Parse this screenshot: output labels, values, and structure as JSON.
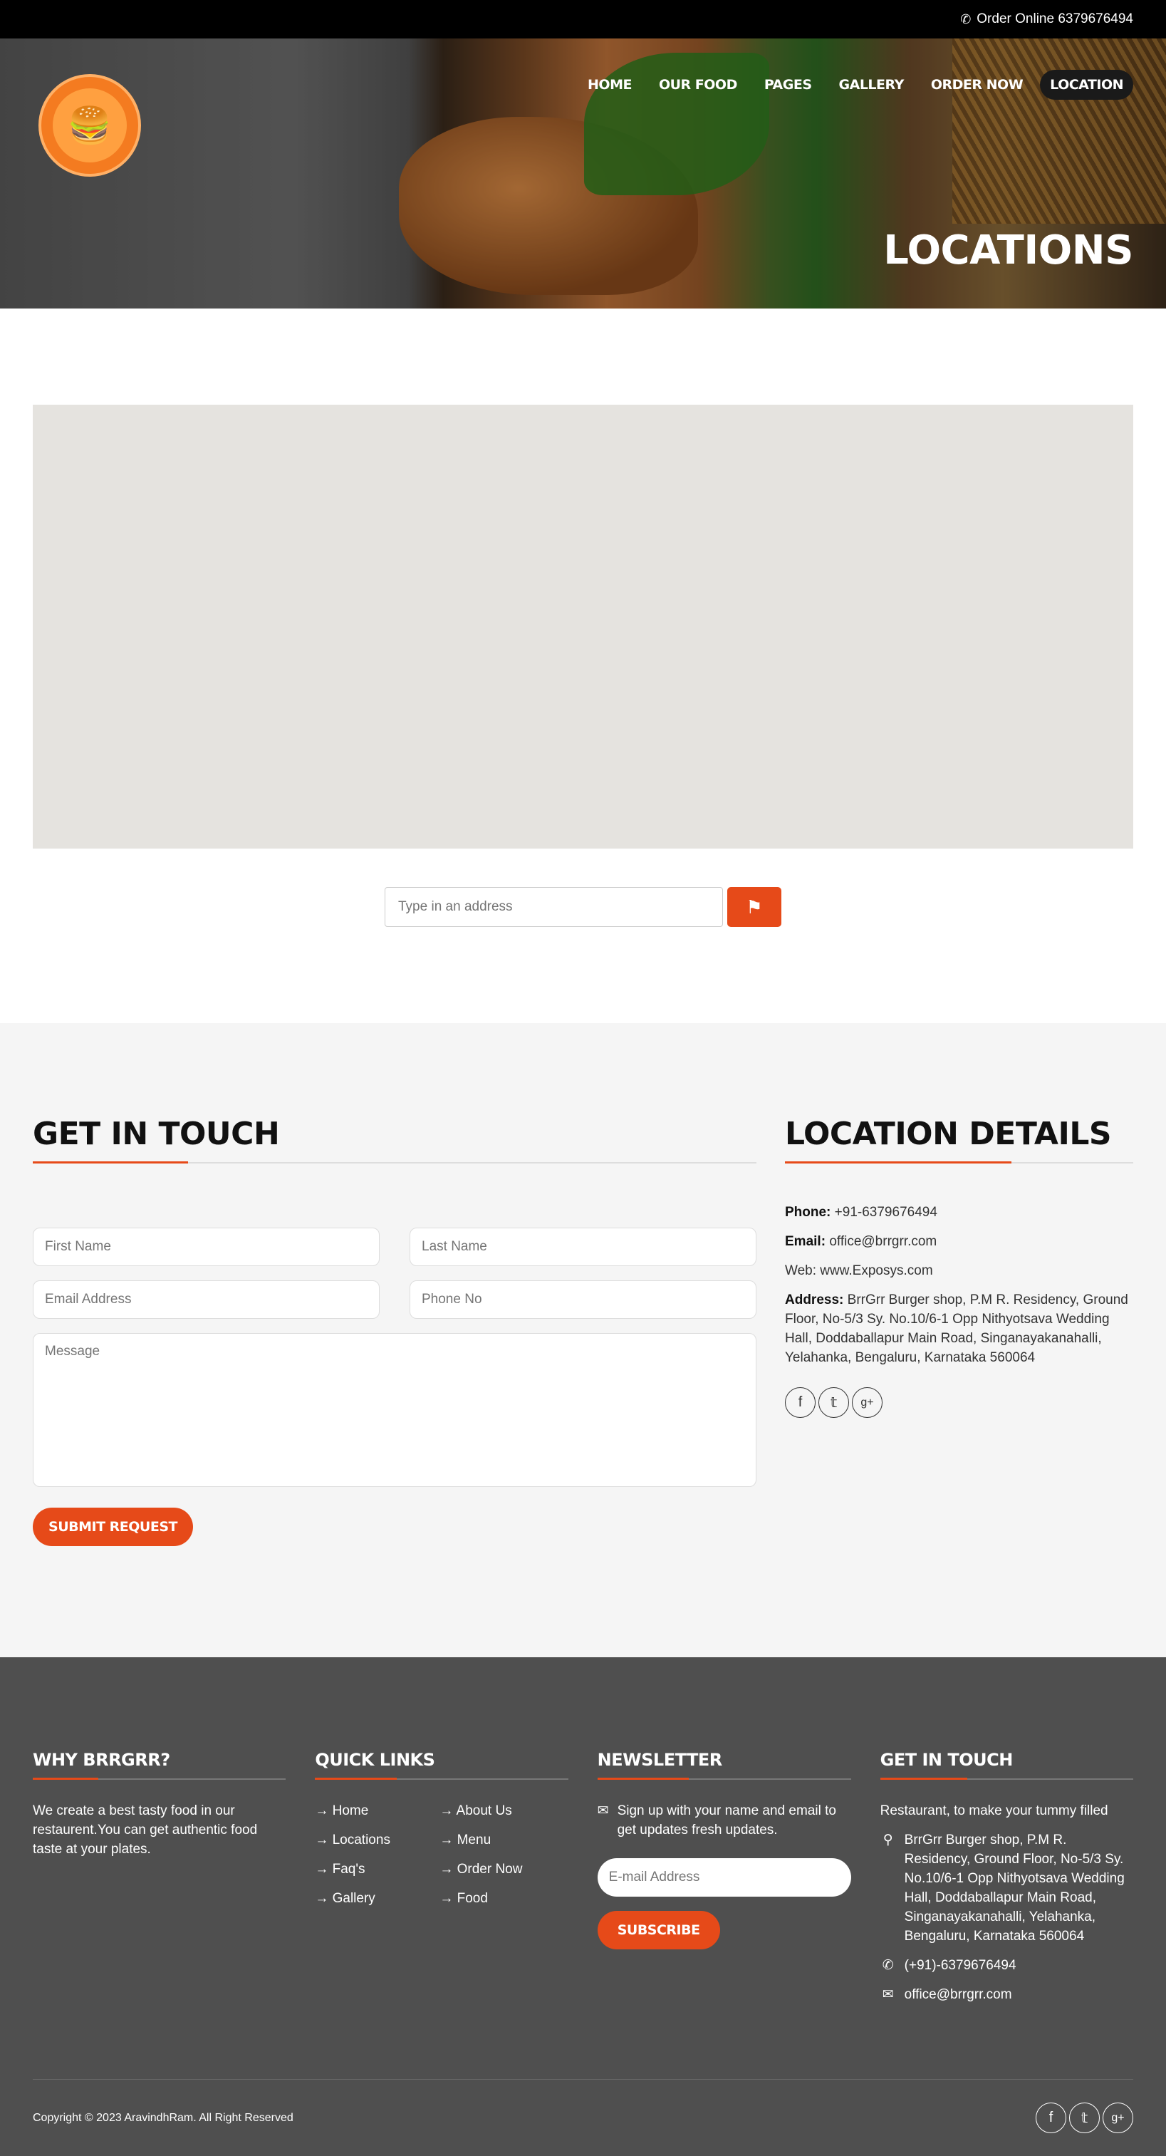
{
  "topbar": {
    "text": "Order Online 6379676494",
    "icon": "phone-icon"
  },
  "nav": {
    "items": [
      {
        "label": "HOME"
      },
      {
        "label": "OUR FOOD"
      },
      {
        "label": "PAGES"
      },
      {
        "label": "GALLERY"
      },
      {
        "label": "ORDER NOW"
      },
      {
        "label": "LOCATION",
        "active": true
      }
    ]
  },
  "hero": {
    "title": "LOCATIONS"
  },
  "map_search": {
    "placeholder": "Type in an address",
    "button_icon": "map-icon"
  },
  "contact": {
    "title": "GET IN TOUCH",
    "fields": {
      "first_name": "First Name",
      "last_name": "Last Name",
      "email": "Email Address",
      "phone": "Phone No",
      "message": "Message"
    },
    "submit": "SUBMIT REQUEST"
  },
  "location": {
    "title": "LOCATION DETAILS",
    "phone_label": "Phone:",
    "phone": "+91-6379676494",
    "email_label": "Email:",
    "email": "office@brrgrr.com",
    "web": "Web: www.Exposys.com",
    "address_label": "Address:",
    "address": "BrrGrr Burger shop, P.M R. Residency, Ground Floor, No-5/3 Sy. No.10/6-1 Opp Nithyotsava Wedding Hall, Doddaballapur Main Road, Singanayakanahalli, Yelahanka, Bengaluru, Karnataka 560064",
    "socials": [
      "facebook-icon",
      "twitter-icon",
      "google-plus-icon"
    ]
  },
  "footer": {
    "why": {
      "title": "WHY BRRGRR?",
      "text": "We create a best tasty food in our restaurent.You can get authentic food taste at your plates."
    },
    "quick_links": {
      "title": "QUICK LINKS",
      "items": [
        "→ Home",
        "→ About Us",
        "→ Locations",
        "→ Menu",
        "→ Faq's",
        "→ Order Now",
        "→ Gallery",
        "→ Food"
      ]
    },
    "newsletter": {
      "title": "NEWSLETTER",
      "text": "Sign up with your name and email to get updates fresh updates.",
      "placeholder": "E-mail Address",
      "button": "SUBSCRIBE"
    },
    "get_in_touch": {
      "title": "GET IN TOUCH",
      "intro": "Restaurant, to make your tummy filled",
      "address": "BrrGrr Burger shop, P.M R. Residency, Ground Floor, No-5/3 Sy. No.10/6-1 Opp Nithyotsava Wedding Hall, Doddaballapur Main Road, Singanayakanahalli, Yelahanka, Bengaluru, Karnataka 560064",
      "phone": "(+91)-6379676494",
      "email": "office@brrgrr.com"
    },
    "copyright": "Copyright © 2023 AravindhRam. All Right Reserved"
  },
  "colors": {
    "accent": "#e64a19",
    "footer_bg": "#4f4f4f",
    "contact_bg": "#f5f5f5",
    "map_bg": "#e5e3df"
  }
}
